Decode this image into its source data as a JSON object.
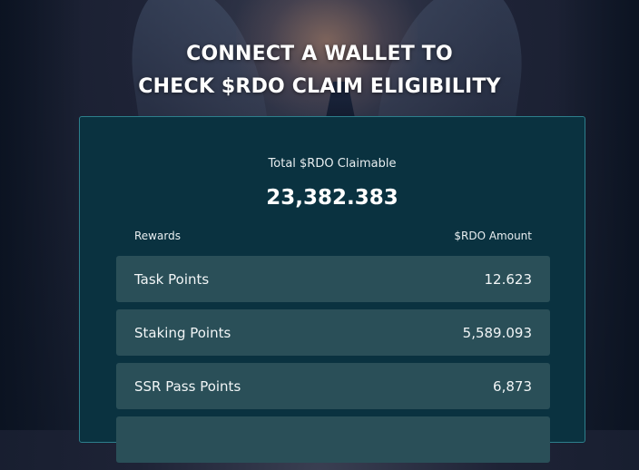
{
  "heading": {
    "line1": "CONNECT A WALLET TO",
    "line2": "CHECK $RDO CLAIM ELIGIBILITY"
  },
  "summary": {
    "total_label": "Total $RDO Claimable",
    "total_value": "23,382.383"
  },
  "table": {
    "col_rewards": "Rewards",
    "col_amount": "$RDO Amount",
    "rows": [
      {
        "label": "Task Points",
        "amount": "12.623"
      },
      {
        "label": "Staking Points",
        "amount": "5,589.093"
      },
      {
        "label": "SSR Pass Points",
        "amount": "6,873"
      }
    ]
  },
  "colors": {
    "panel_bg": "#0a3240",
    "panel_border": "#2d7f8c",
    "row_bg": "#2a4f58"
  }
}
